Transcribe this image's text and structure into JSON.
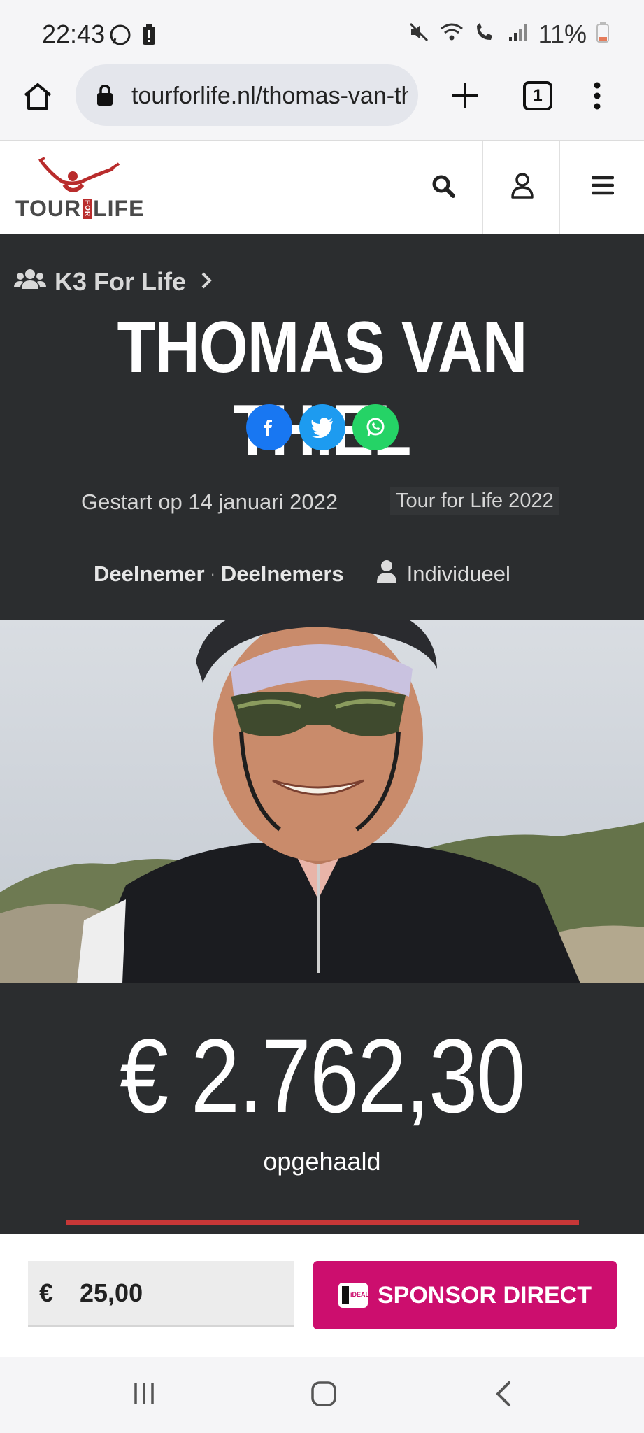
{
  "status_bar": {
    "time": "22:43",
    "battery": "11%"
  },
  "browser": {
    "url": "tourforlife.nl/thomas-van-thiel",
    "tab_count": "1"
  },
  "site": {
    "logo_left": "TOUR",
    "logo_mid": "FOR",
    "logo_right": "LIFE"
  },
  "hero": {
    "team": "K3 For Life",
    "name": "THOMAS VAN THIEL",
    "started": "Gestart op 14 januari 2022",
    "event": "Tour for Life 2022",
    "role": "Deelnemer",
    "role_sep": "·",
    "role_group": "Deelnemers",
    "type": "Individueel"
  },
  "donation": {
    "amount": "€ 2.762,30",
    "label": "opgehaald",
    "progress": 1.0
  },
  "sponsor": {
    "currency": "€",
    "value": "25,00",
    "button": "SPONSOR DIRECT",
    "ideal": "iDEAL"
  },
  "colors": {
    "dark": "#2b2d2f",
    "brand_red": "#c73737",
    "sponsor_pink": "#cc0e6e",
    "facebook": "#1877f2",
    "twitter": "#1d9bf0",
    "whatsapp": "#25d366"
  }
}
